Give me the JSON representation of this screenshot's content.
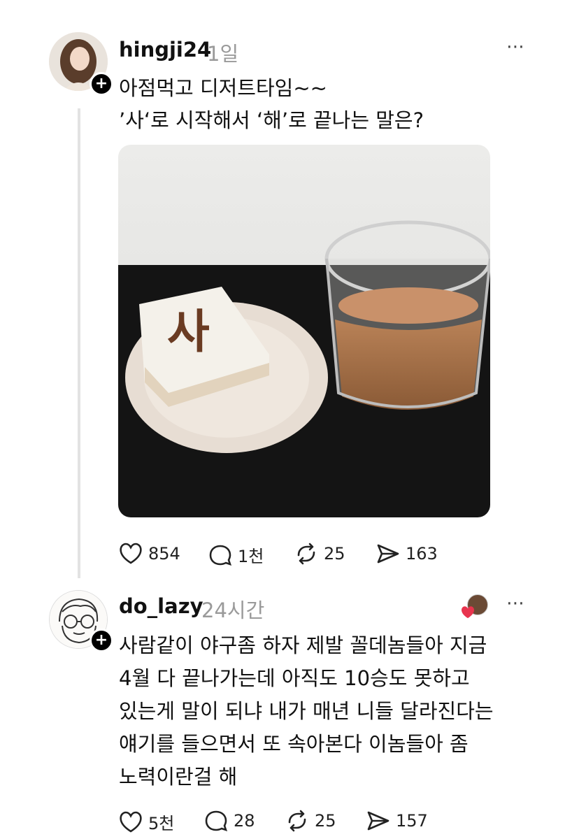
{
  "post": {
    "username": "hingji24",
    "time": "1일",
    "more_icon": "⋯",
    "lines": [
      "아점먹고 디저트타임~~",
      "’사‘로 시작해서 ‘해’로 끝나는 말은?"
    ],
    "cake_char": "사",
    "stats": {
      "likes": "854",
      "comments": "1천",
      "reposts": "25",
      "shares": "163"
    }
  },
  "reply": {
    "username": "do_lazy",
    "time": "24시간",
    "more_icon": "⋯",
    "lines": [
      "사람같이 야구좀 하자 제발 꼴데놈들아 지금",
      "4월 다 끝나가는데 아직도 10승도 못하고",
      "있는게 말이 되냐 내가 매년 니들 달라진다는",
      "얘기를 들으면서 또 속아본다 이놈들아 좀",
      "노력이란걸 해"
    ],
    "stats": {
      "likes": "5천",
      "comments": "28",
      "reposts": "25",
      "shares": "157"
    }
  },
  "colors": {
    "like_heart": "#e8344e",
    "thread_line": "#e2e2e2",
    "muted": "#9a9a9a"
  }
}
